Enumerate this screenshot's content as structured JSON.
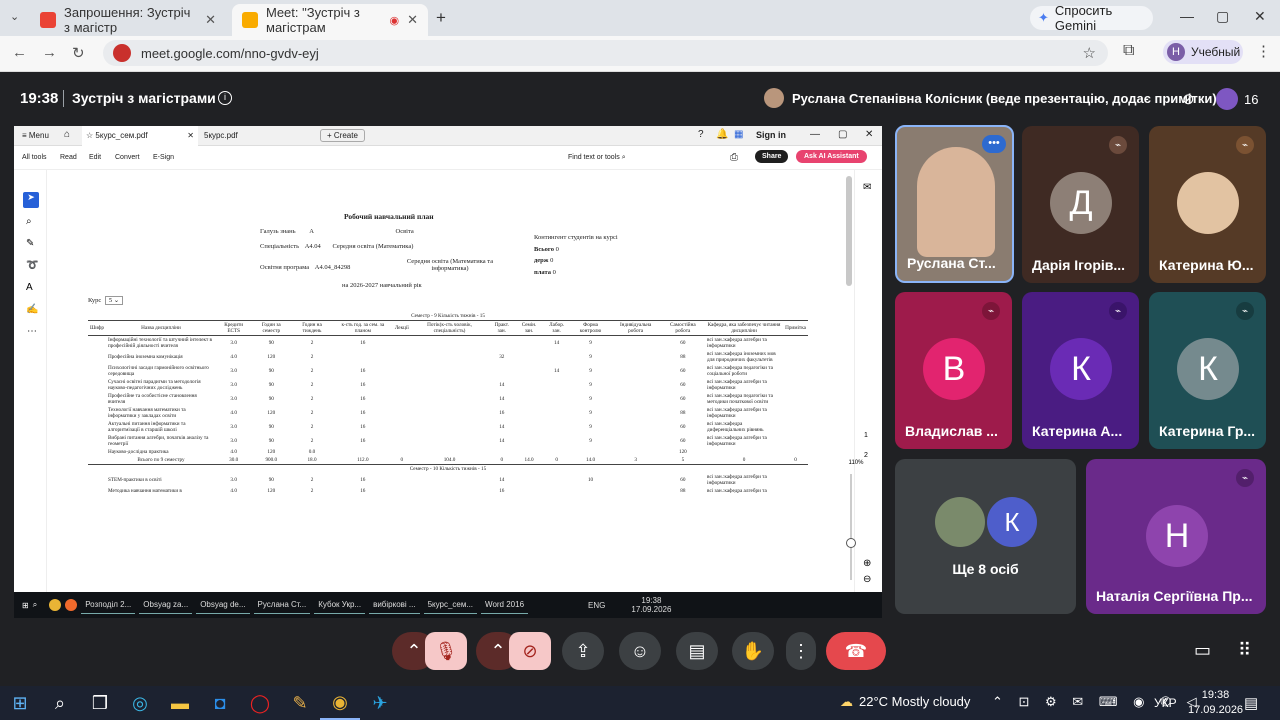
{
  "browser": {
    "tabs": [
      {
        "label": "Запрошення: Зустріч з магістр",
        "active": false
      },
      {
        "label": "Meet: \"Зустріч з магістрам",
        "active": true
      }
    ],
    "gemini_label": "Спросить Gemini",
    "url": "meet.google.com/nno-gvdv-eyj",
    "profile_initial": "Н",
    "profile_label": "Учебный"
  },
  "meet": {
    "time": "19:38",
    "title": "Зустріч з магістрами",
    "presenter": "Руслана Степанівна Колісник (веде презентацію, додає примітки)",
    "participants_count": "16",
    "tiles": [
      {
        "name": "Руслана Ст...",
        "initial": ""
      },
      {
        "name": "Дарія Ігорів...",
        "initial": "Д"
      },
      {
        "name": "Катерина Ю...",
        "initial": ""
      },
      {
        "name": "Владислав ...",
        "initial": "В"
      },
      {
        "name": "Катерина А...",
        "initial": "К"
      },
      {
        "name": "Катерина Гр...",
        "initial": "К"
      },
      {
        "name": "Ще 8 осіб",
        "initial": "К"
      },
      {
        "name": "Наталія Сергіївна Пр...",
        "initial": "Н"
      }
    ]
  },
  "pdf": {
    "menu": "Menu",
    "tab1": "5курс_сем.pdf",
    "tab2": "5курс.pdf",
    "create": "Create",
    "signin": "Sign in",
    "tools": [
      "All tools",
      "Read",
      "Edit",
      "Convert",
      "E-Sign"
    ],
    "find": "Find text or tools",
    "share": "Share",
    "ai": "Ask AI Assistant",
    "zoom": "110%",
    "page_nums": [
      "1",
      "2"
    ],
    "doc": {
      "title": "Робочий навчальний план",
      "galuz_label": "Галузь знань",
      "galuz_code": "А",
      "galuz_value": "Освіта",
      "spec_label": "Спеціальність",
      "spec_code": "А4.04",
      "spec_value": "Середня освіта (Математика)",
      "prog_label": "Освітня програма",
      "prog_code": "А4.04_84298",
      "prog_value": "Середня освіта (Математика та інформатика)",
      "year": "на 2026-2027 навчальний рік",
      "contingent": "Контингент студентів на курсі",
      "total": "Всього",
      "total_v": "0",
      "state": "держ",
      "state_v": "0",
      "paid": "плата",
      "paid_v": "0",
      "course_label": "Курс",
      "course_value": "5",
      "sem9": "Семестр - 9 Кількість тижнів - 15",
      "sem10": "Семестр - 10 Кількість тижнів - 15",
      "headers": [
        "Шифр",
        "Назва дисципліни",
        "Кредити ECTS",
        "Годин за семестр",
        "Годин на тиждень",
        "к-сть год. за сем. за планом",
        "Лекції",
        "Потік(к-сть чоловік, спеціальність)",
        "Практ. зан.",
        "Семін. зан.",
        "Лабор. зан.",
        "Форма контролю",
        "Індивідуальна робота",
        "Самостійна робота",
        "Кафедра, яка забезпечує читання дисципліни",
        "Примітка"
      ],
      "rows": [
        {
          "name": "Інформаційні технології та штучний інтелект в професійній діяльності вчителя",
          "ects": "3.0",
          "hours": "90",
          "week": "2",
          "plan": "16",
          "prakt": "",
          "lab": "14",
          "ctrl": "9",
          "self": "60",
          "dept": "всі зан.:кафедра алгебри та інформатики"
        },
        {
          "name": "Професійна іноземна комунікація",
          "ects": "4.0",
          "hours": "120",
          "week": "2",
          "plan": "",
          "prakt": "32",
          "lab": "",
          "ctrl": "9",
          "self": "88",
          "dept": "всі зан.:кафедра іноземних мов для природничих факультетів"
        },
        {
          "name": "Психологічні засади гармонійного освітнього середовища",
          "ects": "3.0",
          "hours": "90",
          "week": "2",
          "plan": "16",
          "prakt": "",
          "lab": "14",
          "ctrl": "9",
          "self": "60",
          "dept": "всі зан.:кафедра педагогіки та соціальної роботи"
        },
        {
          "name": "Сучасні освітні парадигми та методологія науково-педагогічних досліджень",
          "ects": "3.0",
          "hours": "90",
          "week": "2",
          "plan": "16",
          "prakt": "14",
          "lab": "",
          "ctrl": "9",
          "self": "60",
          "dept": "всі зан.:кафедра алгебри та інформатики"
        },
        {
          "name": "Професійне та особистісне становлення вчителя",
          "ects": "3.0",
          "hours": "90",
          "week": "2",
          "plan": "16",
          "prakt": "14",
          "lab": "",
          "ctrl": "9",
          "self": "60",
          "dept": "всі зан.:кафедра педагогіки та методики початкової освіти"
        },
        {
          "name": "Технології навчання математики та інформатики у закладах освіти",
          "ects": "4.0",
          "hours": "120",
          "week": "2",
          "plan": "16",
          "prakt": "16",
          "lab": "",
          "ctrl": "9",
          "self": "88",
          "dept": "всі зан.:кафедра алгебри та інформатики"
        },
        {
          "name": "Актуальні питання інформатики та алгоритмізації в старшій школі",
          "ects": "3.0",
          "hours": "90",
          "week": "2",
          "plan": "16",
          "prakt": "14",
          "lab": "",
          "ctrl": "9",
          "self": "60",
          "dept": "всі зан.:кафедра диференціальних рівнянь"
        },
        {
          "name": "Вибрані питання алгебри, початків аналізу та геометрії",
          "ects": "3.0",
          "hours": "90",
          "week": "2",
          "plan": "16",
          "prakt": "14",
          "lab": "",
          "ctrl": "9",
          "self": "60",
          "dept": "всі зан.:кафедра алгебри та інформатики"
        },
        {
          "name": "Науково-дослідна практика",
          "ects": "4.0",
          "hours": "120",
          "week": "0.0",
          "plan": "",
          "prakt": "",
          "lab": "",
          "ctrl": "",
          "self": "120",
          "dept": ""
        }
      ],
      "total_row": {
        "name": "Всього по 9 семестру",
        "ects": "30.0",
        "hours": "900.0",
        "week": "18.0",
        "plan": "112.0",
        "a": "0",
        "b": "104.0",
        "c": "0",
        "d": "14.0",
        "e": "0",
        "f": "14.0",
        "g": "3",
        "h": "5",
        "i": "0",
        "j": "0",
        "self": "656"
      },
      "rows10": [
        {
          "name": "STEM-практики в освіті",
          "ects": "3.0",
          "hours": "90",
          "week": "2",
          "plan": "16",
          "prakt": "14",
          "ctrl": "10",
          "self": "60",
          "dept": "всі зан.:кафедра алгебри та інформатики"
        },
        {
          "name": "Методика навчання математики в",
          "ects": "4.0",
          "hours": "120",
          "week": "2",
          "plan": "16",
          "prakt": "16",
          "ctrl": "",
          "self": "88",
          "dept": "всі зан.:кафедра алгебри та"
        }
      ]
    }
  },
  "inner_taskbar": {
    "items": [
      "Розподіл 2...",
      "Obsyag za...",
      "Obsyag de...",
      "Руслана Ст...",
      "Кубок Укр...",
      "вибіркові ...",
      "5курс_сем...",
      "Word 2016"
    ],
    "lang": "ENG",
    "time": "19:38",
    "date": "17.09.2026"
  },
  "taskbar": {
    "weather": "22°C  Mostly cloudy",
    "lang": "УКР",
    "time": "19:38",
    "date": "17.09.2026"
  },
  "colors": {
    "end_call": "#e5484d",
    "mic_off": "#f6c8c8",
    "tile_bg": "#3c4043"
  }
}
